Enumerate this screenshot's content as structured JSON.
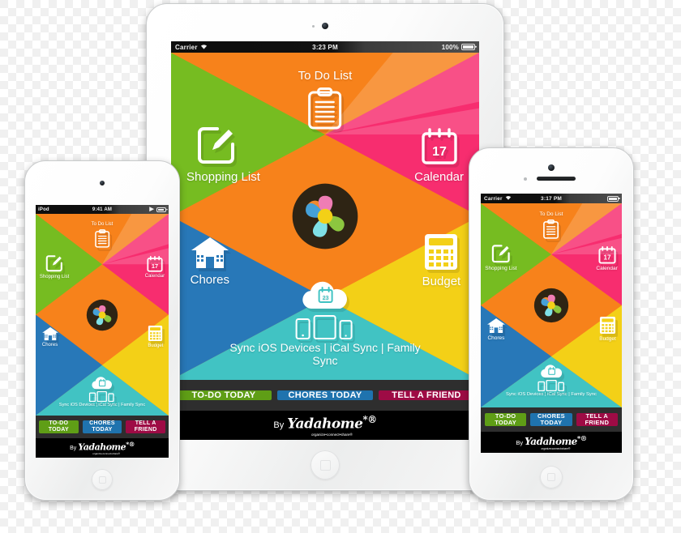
{
  "palette": {
    "green": "#76bc21",
    "orange": "#f7821b",
    "pink": "#f72d6f",
    "blue": "#2878b8",
    "teal": "#41c3c3",
    "yellow": "#f3d017",
    "btn_green": "#5f9e16",
    "btn_blue": "#1f73ae",
    "btn_maroon": "#9e0b45",
    "actionbar_bg": "#2e2e2e",
    "brandbar_bg": "#000000",
    "logo_ring": "#2e2414",
    "logo_center": "#f3d017"
  },
  "tiles": {
    "shopping_list": {
      "label": "Shopping List",
      "icon": "compose-note-icon"
    },
    "to_do_list": {
      "label": "To Do List",
      "icon": "clipboard-icon"
    },
    "calendar": {
      "label": "Calendar",
      "icon": "calendar-icon",
      "day": "17"
    },
    "chores": {
      "label": "Chores",
      "icon": "house-icon"
    },
    "budget": {
      "label": "Budget",
      "icon": "calculator-icon"
    },
    "sync": {
      "label": "Sync iOS Devices | iCal Sync | Family Sync",
      "icon": "cloud-sync-icon",
      "day": "23"
    }
  },
  "actions": [
    {
      "label": "TO-DO TODAY",
      "name": "todo-today-button",
      "color": "green"
    },
    {
      "label": "CHORES TODAY",
      "name": "chores-today-button",
      "color": "blue"
    },
    {
      "label": "TELL A FRIEND",
      "name": "tell-a-friend-button",
      "color": "maroon"
    }
  ],
  "brand": {
    "by": "By",
    "word": "Yadahome",
    "star": "*®",
    "tagline": "organize•connect•share®"
  },
  "logo": {
    "name": "yadahome-pinwheel-logo"
  },
  "devices": {
    "ipad": {
      "name": "iPad",
      "status": {
        "carrier": "Carrier",
        "wifi": "wifi-icon",
        "time": "3:23 PM",
        "battery_pct": "100%",
        "battery_level": 100
      }
    },
    "ipod": {
      "name": "iPod touch",
      "status": {
        "carrier": "iPod",
        "time": "9:41 AM",
        "play": "▶",
        "battery_level": 90
      }
    },
    "iphone": {
      "name": "iPhone",
      "status": {
        "carrier": "Carrier",
        "wifi": "wifi-icon",
        "time": "3:17 PM",
        "battery_level": 100
      }
    }
  }
}
